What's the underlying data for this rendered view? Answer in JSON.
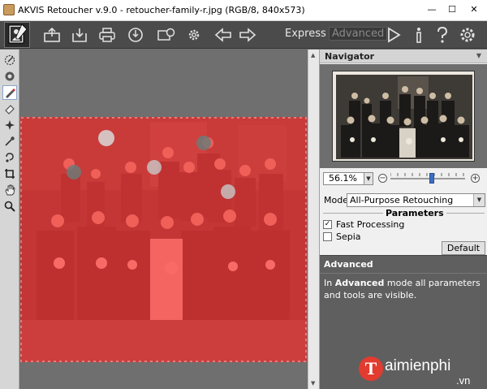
{
  "window": {
    "title": "AKVIS Retoucher v.9.0 - retoucher-family-r.jpg (RGB/8, 840x573)",
    "minimize_glyph": "—",
    "maximize_glyph": "☐",
    "close_glyph": "✕"
  },
  "toolbar": {
    "icons": [
      "open-image-icon",
      "save-image-icon",
      "print-icon",
      "share-icon",
      "batch-processing-icon",
      "preferences-icon",
      "undo-icon",
      "redo-icon",
      "run-icon",
      "info-icon",
      "help-icon",
      "settings-icon"
    ],
    "mode_express": "Express",
    "mode_advanced": "Advanced",
    "mode_active": "Advanced"
  },
  "left_tools": {
    "icons": [
      "selection-brush-icon",
      "magic-wand-icon",
      "brush-icon",
      "eraser-icon",
      "chameleon-brush-icon",
      "clone-stamp-icon",
      "healing-brush-icon",
      "crop-icon",
      "hand-icon",
      "zoom-icon"
    ],
    "active": "brush-icon"
  },
  "navigator": {
    "title": "Navigator",
    "zoom_value": "56.1%",
    "zoom_slider_fraction": 0.55
  },
  "settings": {
    "mode_label": "Mode:",
    "mode_value": "All-Purpose Retouching",
    "parameters_title": "Parameters",
    "fast_processing_label": "Fast Processing",
    "fast_processing_checked": true,
    "sepia_label": "Sepia",
    "sepia_checked": false,
    "default_button": "Default"
  },
  "help": {
    "title": "Advanced",
    "text_prefix": "In ",
    "text_bold": "Advanced",
    "text_suffix": " mode all parameters and tools are visible."
  },
  "watermark": {
    "logo_letter": "T",
    "name": "aimienphi",
    "tld": ".vn"
  },
  "colors": {
    "mask_overlay": "#ff3b3b",
    "toolbar_bg": "#4b4b4b",
    "accent": "#3a6fc4"
  }
}
